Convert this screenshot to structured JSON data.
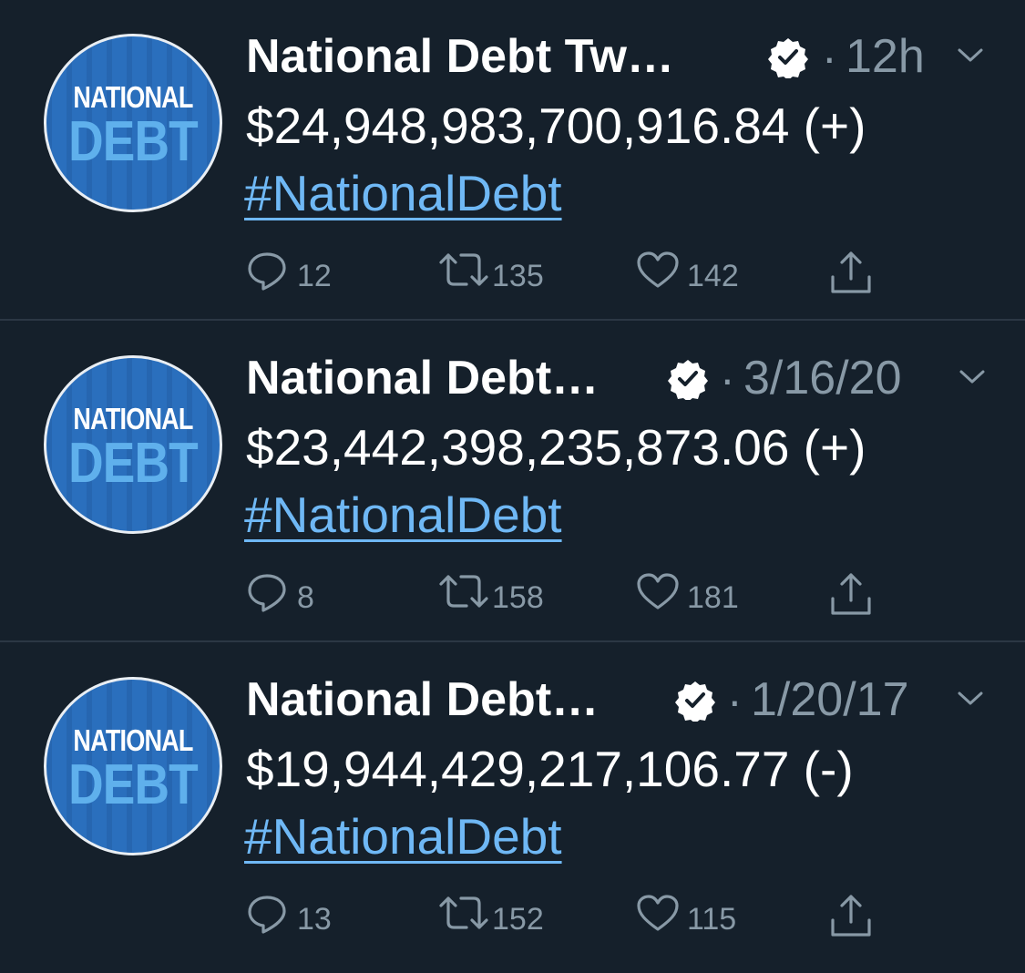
{
  "tweets": [
    {
      "name": "National Debt Tw…",
      "time": "12h",
      "amount": "$24,948,983,700,916.84 (+)",
      "hashtag": "#NationalDebt",
      "replies": "12",
      "retweets": "135",
      "likes": "142"
    },
    {
      "name": "National Debt…",
      "time": "3/16/20",
      "amount": "$23,442,398,235,873.06 (+)",
      "hashtag": "#NationalDebt",
      "replies": "8",
      "retweets": "158",
      "likes": "181"
    },
    {
      "name": "National Debt…",
      "time": "1/20/17",
      "amount": "$19,944,429,217,106.77 (-)",
      "hashtag": "#NationalDebt",
      "replies": "13",
      "retweets": "152",
      "likes": "115"
    }
  ],
  "avatar": {
    "line1": "NATIONAL",
    "line2": "DEBT"
  },
  "icons": {
    "verified": "verified-badge-icon",
    "chevron": "chevron-down-icon",
    "reply": "reply-icon",
    "retweet": "retweet-icon",
    "like": "heart-icon",
    "share": "share-icon"
  },
  "colors": {
    "background": "#15202b",
    "muted": "#8899a6",
    "link": "#6fb8f5",
    "avatar_blue": "#2a6fbd",
    "avatar_text_light": "#5fb0ec"
  }
}
